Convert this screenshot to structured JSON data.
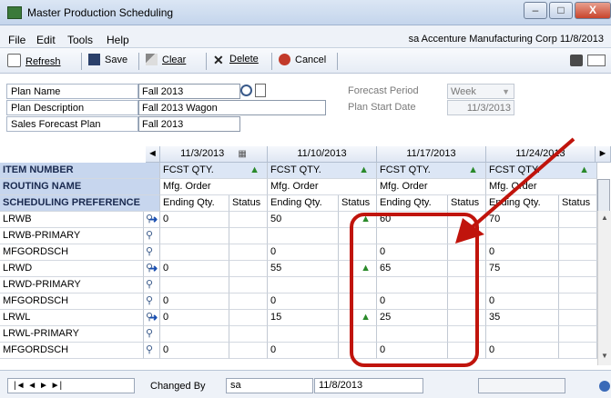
{
  "window": {
    "title": "Master Production Scheduling",
    "minimize": "–",
    "maximize": "□",
    "close": "X"
  },
  "menu": {
    "items": [
      "File",
      "Edit",
      "Tools",
      "Help"
    ],
    "right_text": "sa  Accenture Manufacturing Corp 11/8/2013"
  },
  "toolbar": {
    "refresh": "Refresh",
    "save": "Save",
    "clear": "Clear",
    "delete": "Delete",
    "cancel": "Cancel"
  },
  "plan": {
    "plan_name_label": "Plan Name",
    "plan_name": "Fall 2013",
    "plan_description_label": "Plan Description",
    "plan_description": "Fall 2013 Wagon",
    "sales_forecast_label": "Sales Forecast Plan",
    "sales_forecast": "Fall 2013",
    "forecast_period_label": "Forecast Period",
    "forecast_period": "Week",
    "plan_start_label": "Plan Start Date",
    "plan_start": "11/3/2013"
  },
  "grid": {
    "dates": [
      "11/3/2013",
      "11/10/2013",
      "11/17/2013",
      "11/24/2013"
    ],
    "row_headers": [
      "ITEM NUMBER",
      "ROUTING NAME",
      "SCHEDULING PREFERENCE"
    ],
    "fcst_label": "FCST QTY.",
    "routing_value": "Mfg. Order",
    "ending_label": "Ending Qty.",
    "status_label": "Status",
    "rows": [
      {
        "item": "LRWB",
        "values": [
          "0",
          "50",
          "60",
          "70"
        ]
      },
      {
        "item": "LRWB-PRIMARY",
        "values": [
          "",
          "",
          "",
          ""
        ]
      },
      {
        "item": "MFGORDSCH",
        "values": [
          "",
          "0",
          "0",
          "0"
        ]
      },
      {
        "item": "LRWD",
        "values": [
          "0",
          "55",
          "65",
          "75"
        ]
      },
      {
        "item": "LRWD-PRIMARY",
        "values": [
          "",
          "",
          "",
          ""
        ]
      },
      {
        "item": "MFGORDSCH",
        "values": [
          "0",
          "0",
          "0",
          "0"
        ]
      },
      {
        "item": "LRWL",
        "values": [
          "0",
          "15",
          "25",
          "35"
        ]
      },
      {
        "item": "LRWL-PRIMARY",
        "values": [
          "",
          "",
          "",
          ""
        ]
      },
      {
        "item": "MFGORDSCH",
        "values": [
          "0",
          "0",
          "0",
          "0"
        ]
      }
    ]
  },
  "status": {
    "changed_by_label": "Changed By",
    "changed_by": "sa",
    "date": "11/8/2013"
  },
  "colors": {
    "highlight": "#c0140c",
    "header_blue": "#c7d6ee"
  }
}
